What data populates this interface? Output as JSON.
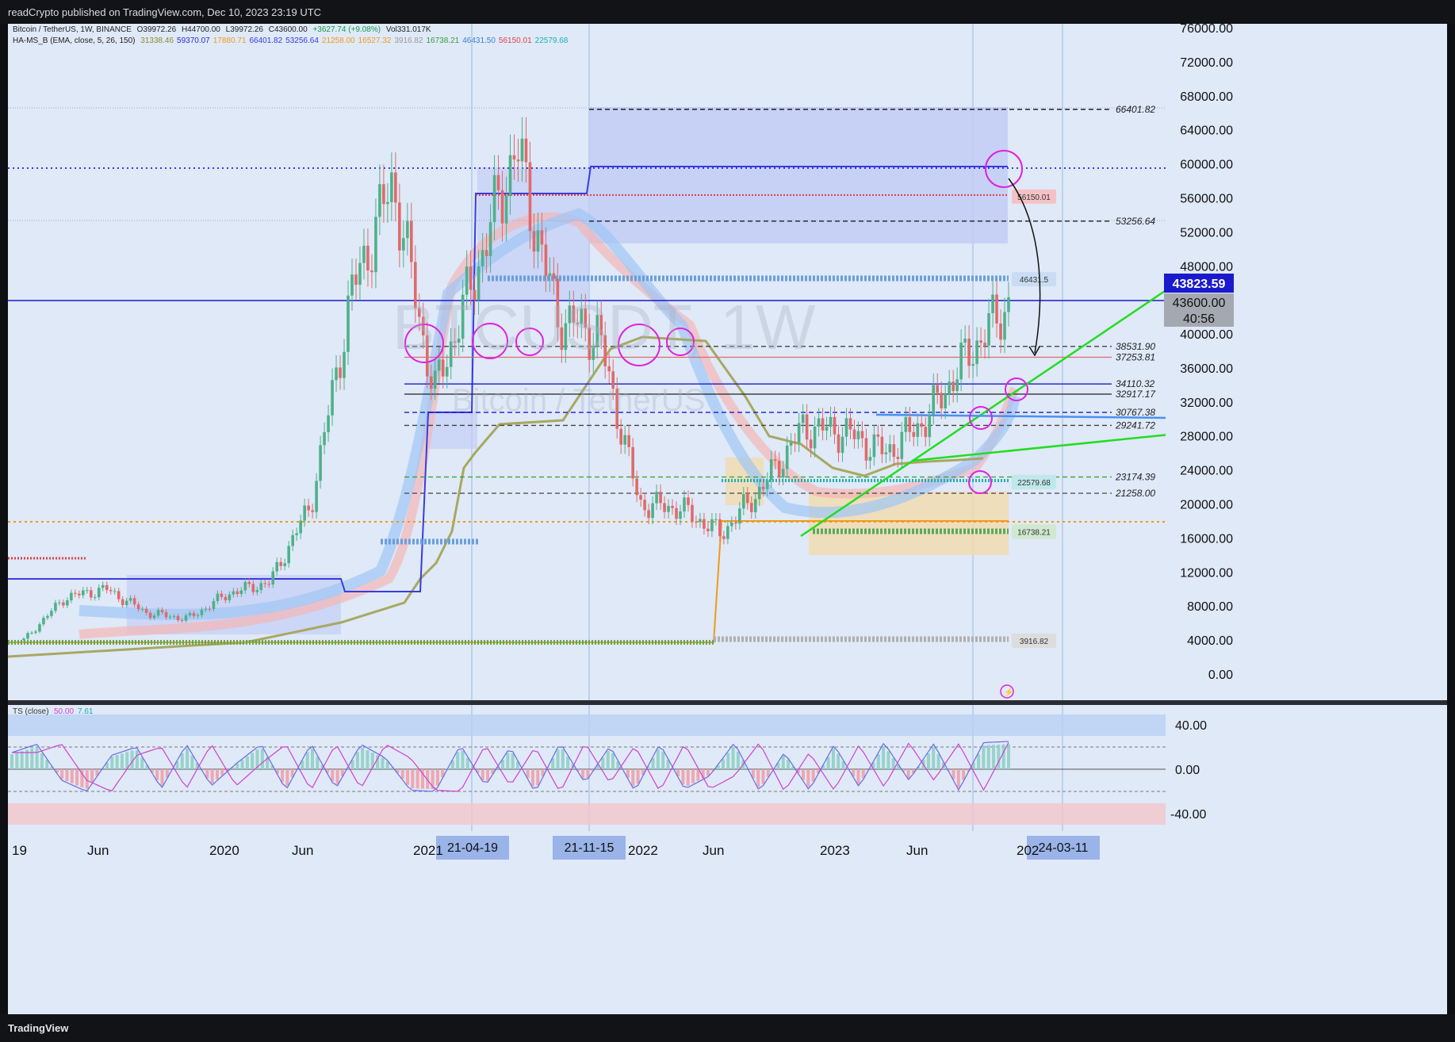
{
  "header": {
    "publish_text": "readCrypto published on TradingView.com, Dec 10, 2023 23:19 UTC"
  },
  "footer": {
    "brand": "TradingView"
  },
  "legend": {
    "symbol_line": "Bitcoin / TetherUS, 1W, BINANCE",
    "open": "O39972.26",
    "high": "H44700.00",
    "low": "L39972.26",
    "close": "C43600.00",
    "change": "+3627.74 (+9.08%)",
    "volume": "Vol331.017K",
    "indicator_name": "HA-MS_B (EMA, close, 5, 26, 150)",
    "indicator_values": [
      {
        "text": "31338.46",
        "color": "#8c8c2a"
      },
      {
        "text": "59370.07",
        "color": "#2b2bd6"
      },
      {
        "text": "17880.71",
        "color": "#f09a1a"
      },
      {
        "text": "66401.82",
        "color": "#3a3ae0"
      },
      {
        "text": "53256.64",
        "color": "#3a3ae0"
      },
      {
        "text": "21258.00",
        "color": "#f09a1a"
      },
      {
        "text": "16527.32",
        "color": "#f09a1a"
      },
      {
        "text": "3916.82",
        "color": "#9a9a9a"
      },
      {
        "text": "16738.21",
        "color": "#3d9a3d"
      },
      {
        "text": "46431.50",
        "color": "#3d7fd6"
      },
      {
        "text": "56150.01",
        "color": "#e0404a"
      },
      {
        "text": "22579.68",
        "color": "#1fb0b0"
      }
    ],
    "ts_label": "TS (close)",
    "ts_val1": "50.00",
    "ts_val2": "7.61"
  },
  "watermark": {
    "ticker": "BTCUSDT, 1W",
    "name": "Bitcoin / TetherUS"
  },
  "price_axis": {
    "ticks": [
      "76000.00",
      "72000.00",
      "68000.00",
      "64000.00",
      "60000.00",
      "56000.00",
      "52000.00",
      "48000.00",
      "44000.00",
      "40000.00",
      "36000.00",
      "32000.00",
      "28000.00",
      "24000.00",
      "20000.00",
      "16000.00",
      "12000.00",
      "8000.00",
      "4000.00",
      "0.00"
    ],
    "current_price": "43823.59",
    "last_price": "43600.00",
    "countdown": "40:56"
  },
  "levels": [
    {
      "label": "66401.82",
      "value": 66401.82,
      "style": "dash",
      "color": "#111111"
    },
    {
      "label": "53256.64",
      "value": 53256.64,
      "style": "dash",
      "color": "#111111"
    },
    {
      "label": "38531.90",
      "value": 38531.9,
      "style": "dash",
      "color": "#444444"
    },
    {
      "label": "37253.81",
      "value": 37253.81,
      "style": "solid",
      "color": "#e06a6a"
    },
    {
      "label": "34110.32",
      "value": 34110.32,
      "style": "solid",
      "color": "#1a1acc"
    },
    {
      "label": "32917.17",
      "value": 32917.17,
      "style": "solid",
      "color": "#222222"
    },
    {
      "label": "30767.38",
      "value": 30767.38,
      "style": "dash",
      "color": "#1a1acc"
    },
    {
      "label": "29241.72",
      "value": 29241.72,
      "style": "dash",
      "color": "#444444"
    },
    {
      "label": "23174.39",
      "value": 23174.39,
      "style": "dash",
      "color": "#2e9e2e"
    },
    {
      "label": "21258.00",
      "value": 21258.0,
      "style": "dash",
      "color": "#444444"
    }
  ],
  "tags": [
    {
      "label": "56150.01",
      "value": 56150.01,
      "bg": "#f4c2c6"
    },
    {
      "label": "46431.5",
      "value": 46431.5,
      "bg": "#c9dcf3"
    },
    {
      "label": "22579.68",
      "value": 22579.68,
      "bg": "#bfe8ea"
    },
    {
      "label": "16738.21",
      "value": 16738.21,
      "bg": "#cfe8cf"
    },
    {
      "label": "3916.82",
      "value": 3916.82,
      "bg": "#dddddd"
    }
  ],
  "time_axis": {
    "labels": [
      "19",
      "Jun",
      "2020",
      "Jun",
      "2021",
      "2022",
      "Jun",
      "2023",
      "Jun",
      "202"
    ],
    "highlights": [
      "21-04-19",
      "21-11-15",
      "24-03-11"
    ]
  },
  "ts_axis": {
    "ticks": [
      "40.00",
      "0.00",
      "-40.00"
    ]
  },
  "chart_data": {
    "type": "line",
    "title": "Bitcoin / TetherUS, 1W, BINANCE",
    "ylim": [
      -2000,
      78000
    ],
    "x": [
      "2019-03",
      "2019-06",
      "2019-09",
      "2019-12",
      "2020-03",
      "2020-06",
      "2020-09",
      "2020-12",
      "2021-02",
      "2021-04",
      "2021-06",
      "2021-09",
      "2021-11",
      "2022-01",
      "2022-04",
      "2022-06",
      "2022-09",
      "2022-11",
      "2023-01",
      "2023-04",
      "2023-06",
      "2023-09",
      "2023-10",
      "2023-11",
      "2023-12"
    ],
    "series": [
      {
        "name": "BTCUSDT",
        "values": [
          4000,
          9000,
          10000,
          7200,
          6500,
          9500,
          10800,
          20000,
          45000,
          58000,
          33000,
          47000,
          62000,
          42000,
          40000,
          20000,
          19500,
          16500,
          22000,
          29000,
          28500,
          26000,
          30000,
          37500,
          43600
        ]
      }
    ]
  },
  "ts_data": {
    "values": [
      30,
      45,
      -20,
      -40,
      25,
      40,
      -35,
      45,
      -30,
      10,
      45,
      -38,
      46,
      -35,
      45,
      20,
      -38,
      -40,
      44,
      -30,
      40,
      -42,
      48,
      -25,
      42,
      -40,
      46,
      -36,
      -12,
      48,
      -40,
      30,
      -38,
      44,
      -32,
      48,
      -20,
      46,
      -38,
      48,
      50
    ]
  }
}
